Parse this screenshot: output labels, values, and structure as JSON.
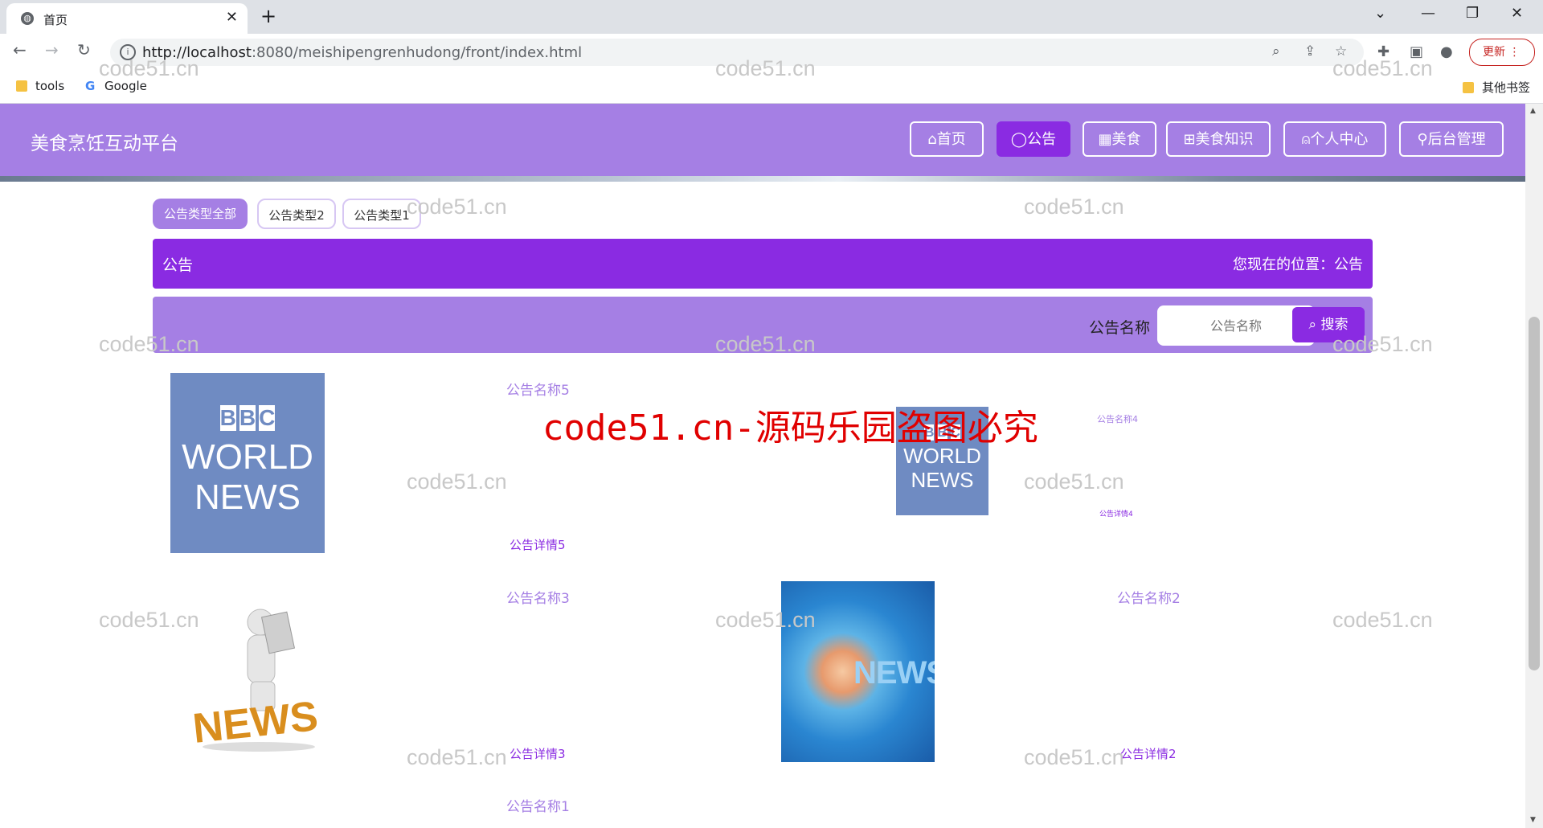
{
  "browser": {
    "tab_title": "首页",
    "url_host": "http://localhost",
    "url_rest": ":8080/meishipengrenhudong/front/index.html",
    "update_label": "更新",
    "bookmarks": [
      "tools",
      "Google"
    ],
    "other_bookmarks": "其他书签"
  },
  "header": {
    "site_title": "美食烹饪互动平台",
    "nav": [
      {
        "icon": "home-icon",
        "label": "首页",
        "active": false
      },
      {
        "icon": "notice-icon",
        "label": "公告",
        "active": true
      },
      {
        "icon": "food-icon",
        "label": "美食",
        "active": false
      },
      {
        "icon": "knowledge-icon",
        "label": "美食知识",
        "active": false
      },
      {
        "icon": "user-icon",
        "label": "个人中心",
        "active": false
      },
      {
        "icon": "link-icon",
        "label": "后台管理",
        "active": false
      }
    ]
  },
  "filters": [
    {
      "label": "公告类型全部",
      "active": true
    },
    {
      "label": "公告类型2",
      "active": false
    },
    {
      "label": "公告类型1",
      "active": false
    }
  ],
  "section": {
    "title": "公告",
    "location": "您现在的位置：公告"
  },
  "search": {
    "label": "公告名称",
    "placeholder": "公告名称",
    "button": "搜索"
  },
  "notices": [
    {
      "name": "公告名称5",
      "detail": "公告详情5",
      "image": "BBC WORLD NEWS"
    },
    {
      "name": "公告名称4",
      "detail": "公告详情4",
      "image": "BBC WORLD NEWS"
    },
    {
      "name": "公告名称3",
      "detail": "公告详情3",
      "image": "NEWS"
    },
    {
      "name": "公告名称2",
      "detail": "公告详情2",
      "image": "NEWS"
    },
    {
      "name": "公告名称1"
    }
  ],
  "watermark": "code51.cn",
  "big_watermark": "code51.cn-源码乐园盗图必究",
  "colors": {
    "brand": "#a57fe4",
    "accent": "#8a2be2"
  }
}
